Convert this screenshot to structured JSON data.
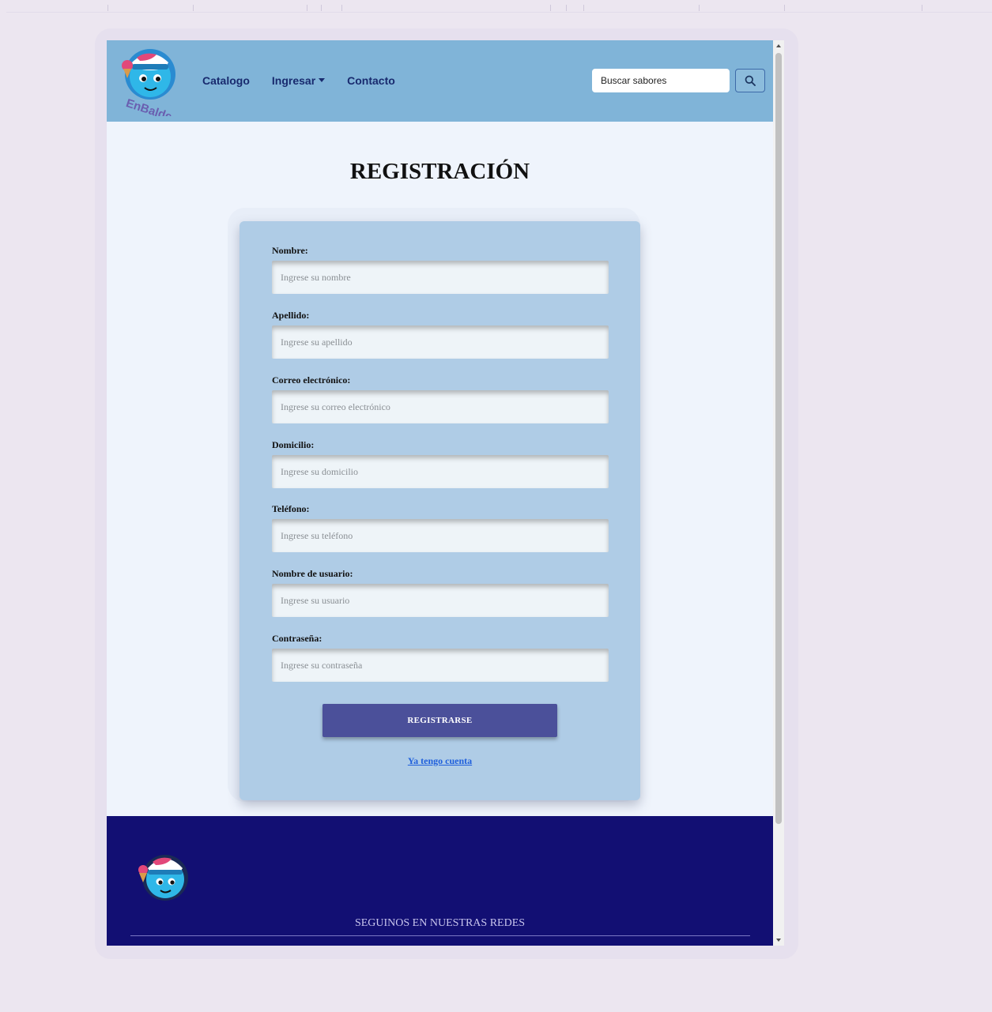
{
  "brand": {
    "name": "EnBalde",
    "logo_icon": "ice-cream-mascot-icon"
  },
  "nav": {
    "links": [
      {
        "label": "Catalogo"
      },
      {
        "label": "Ingresar",
        "has_dropdown": true
      },
      {
        "label": "Contacto"
      }
    ],
    "search": {
      "placeholder": "Buscar sabores",
      "button_icon": "search-icon"
    }
  },
  "page": {
    "title": "REGISTRACIÓN"
  },
  "form": {
    "fields": [
      {
        "label": "Nombre:",
        "placeholder": "Ingrese su nombre"
      },
      {
        "label": "Apellido:",
        "placeholder": "Ingrese su apellido"
      },
      {
        "label": "Correo electrónico:",
        "placeholder": "Ingrese su correo electrónico"
      },
      {
        "label": "Domicilio:",
        "placeholder": "Ingrese su domicilio"
      },
      {
        "label": "Teléfono:",
        "placeholder": "Ingrese su teléfono"
      },
      {
        "label": "Nombre de usuario:",
        "placeholder": "Ingrese su usuario"
      },
      {
        "label": "Contraseña:",
        "placeholder": "Ingrese su contraseña"
      }
    ],
    "submit_label": "REGISTRARSE",
    "login_link": "Ya tengo cuenta"
  },
  "footer": {
    "social_title": "SEGUINOS EN NUESTRAS REDES"
  },
  "colors": {
    "navbar": "#80b4d8",
    "card": "#afcce6",
    "button": "#4b509a",
    "footer": "#120f73",
    "link": "#1f5fdc"
  }
}
